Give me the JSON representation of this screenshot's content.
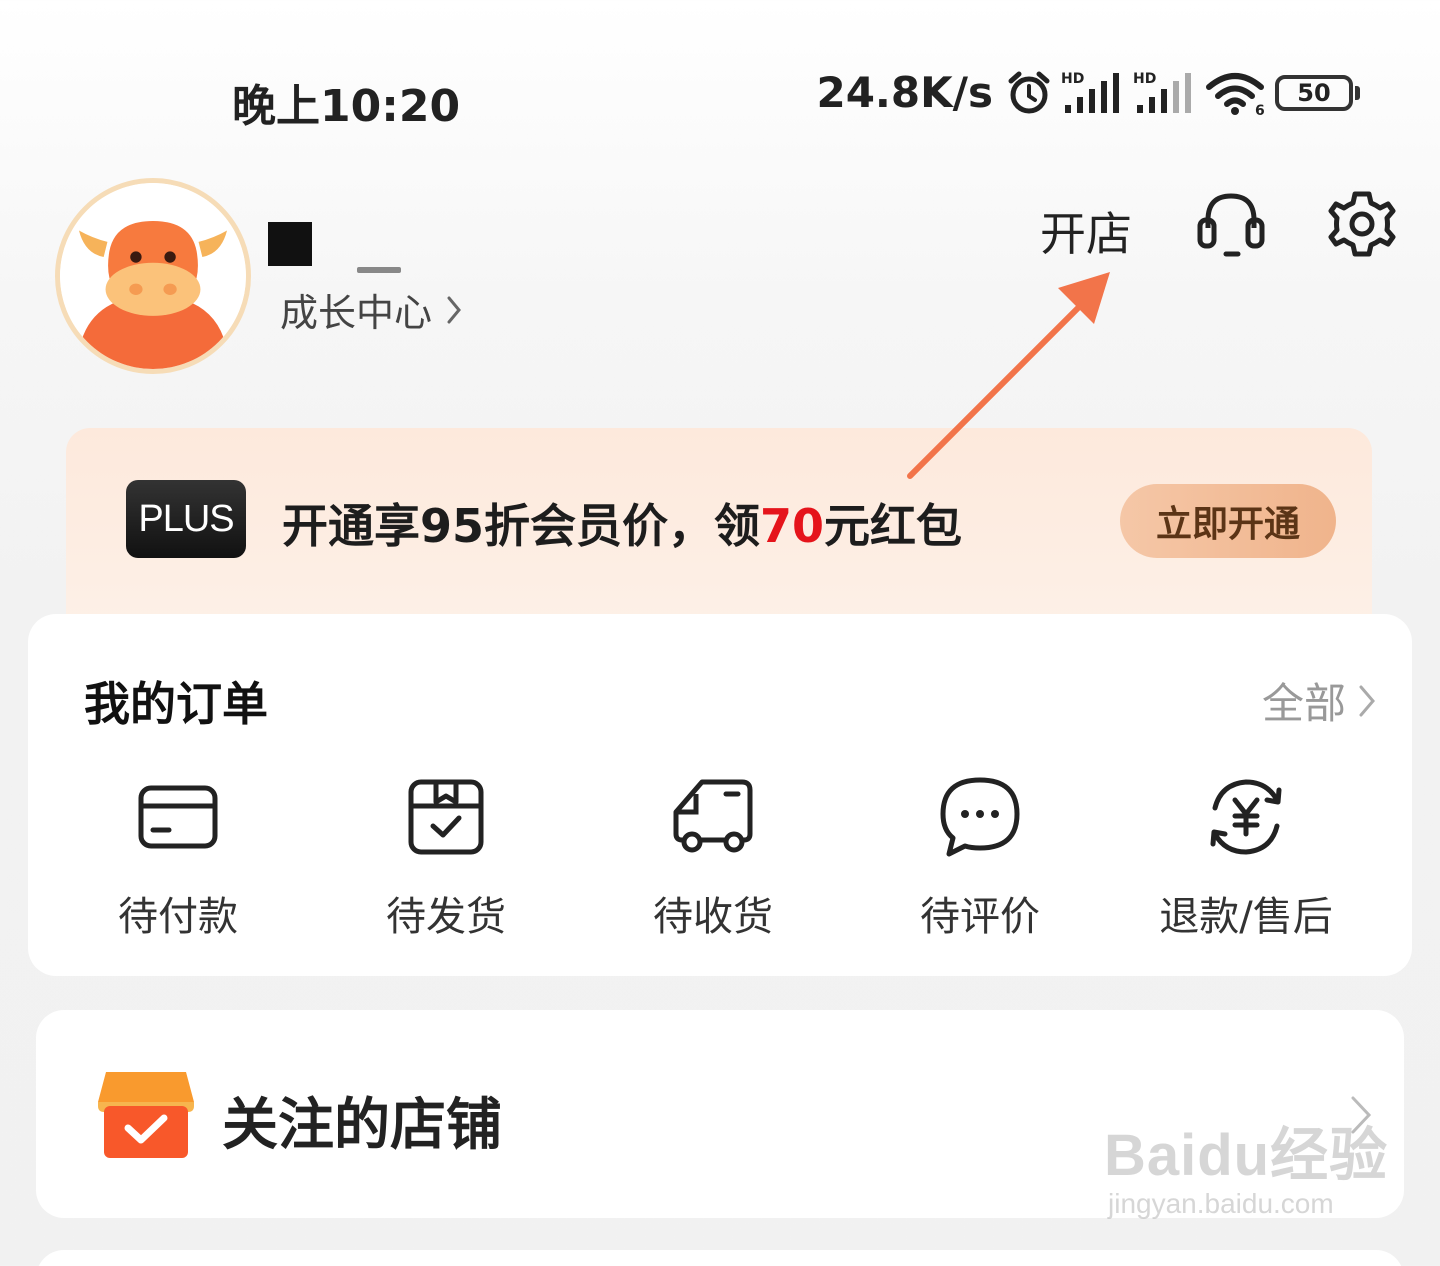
{
  "status_bar": {
    "time": "晚上10:20",
    "network_speed": "24.8K/s",
    "battery": "50",
    "icons": [
      "alarm-icon",
      "hd-signal-icon",
      "hd-signal-icon",
      "wifi-icon",
      "battery-icon"
    ]
  },
  "profile": {
    "growth_center": "成长中心",
    "open_store": "开店",
    "icons": [
      "avatar",
      "headset-icon",
      "gear-icon",
      "chevron-right-icon"
    ]
  },
  "plus_banner": {
    "badge": "PLUS",
    "text_before": "开通享95折会员价，领",
    "text_highlight": "70",
    "text_after": "元红包",
    "button": "立即开通",
    "highlight_color": "#e5141b"
  },
  "orders": {
    "title": "我的订单",
    "all_label": "全部",
    "items": [
      {
        "label": "待付款",
        "icon": "wallet-icon"
      },
      {
        "label": "待发货",
        "icon": "package-icon"
      },
      {
        "label": "待收货",
        "icon": "truck-icon"
      },
      {
        "label": "待评价",
        "icon": "chat-bubble-icon"
      },
      {
        "label": "退款/售后",
        "icon": "refund-icon"
      }
    ]
  },
  "followed_stores": {
    "label": "关注的店铺",
    "icon": "store-icon"
  },
  "watermark": {
    "main": "Baidu经验",
    "sub": "jingyan.baidu.com"
  },
  "annotation": {
    "arrow_color": "#f2744a"
  }
}
